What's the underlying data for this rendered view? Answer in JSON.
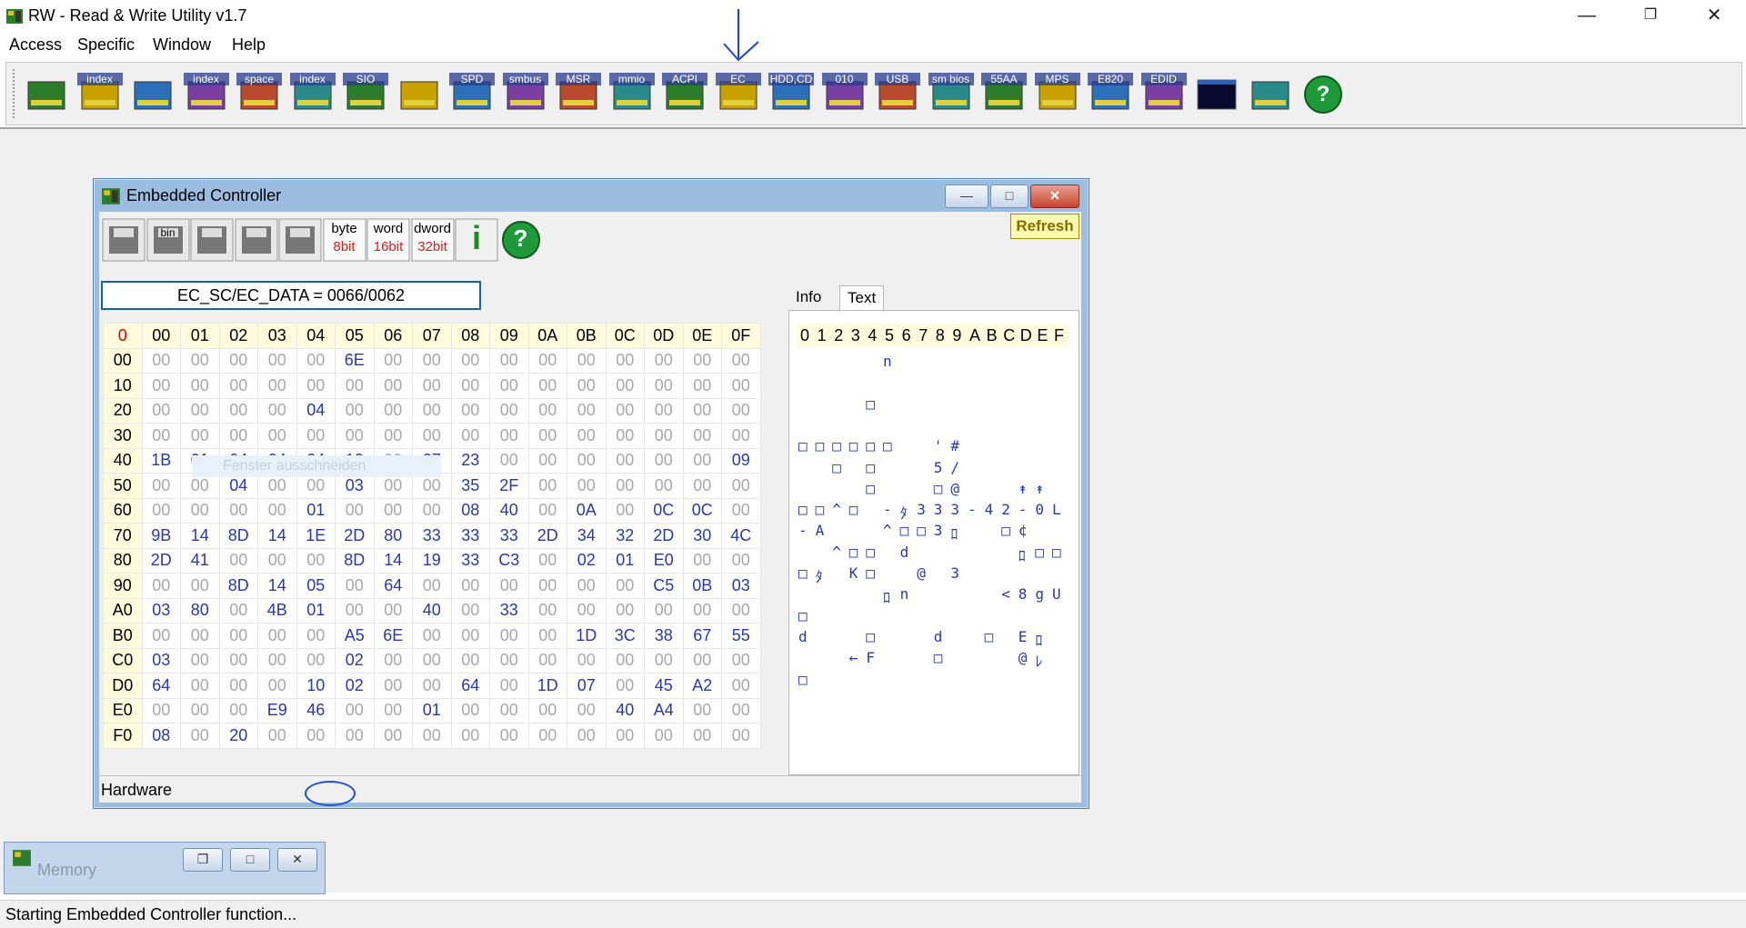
{
  "app": {
    "title": "RW - Read & Write Utility v1.7",
    "window_controls": {
      "minimize": "—",
      "restore": "❐",
      "close": "✕"
    }
  },
  "menu": [
    "Access",
    "Specific",
    "Window",
    "Help"
  ],
  "toolbar": {
    "tools": [
      {
        "name": "pci-tool-icon",
        "label": ""
      },
      {
        "name": "pci-index-tool-icon",
        "label": "index"
      },
      {
        "name": "memory-tool-icon",
        "label": ""
      },
      {
        "name": "memory-index-tool-icon",
        "label": "index"
      },
      {
        "name": "io-space-tool-icon",
        "label": "space"
      },
      {
        "name": "io-index-tool-icon",
        "label": "index"
      },
      {
        "name": "sio-tool-icon",
        "label": "SIO"
      },
      {
        "name": "waveform-tool-icon",
        "label": ""
      },
      {
        "name": "spd-tool-icon",
        "label": "SPD"
      },
      {
        "name": "smbus-tool-icon",
        "label": "smbus"
      },
      {
        "name": "msr-tool-icon",
        "label": "MSR"
      },
      {
        "name": "mmio-tool-icon",
        "label": "mmio"
      },
      {
        "name": "acpi-tool-icon",
        "label": "ACPI"
      },
      {
        "name": "ec-tool-icon",
        "label": "EC"
      },
      {
        "name": "hdd-cd-tool-icon",
        "label": "HDD,CD"
      },
      {
        "name": "disk-010-tool-icon",
        "label": "010"
      },
      {
        "name": "usb-tool-icon",
        "label": "USB"
      },
      {
        "name": "smbios-tool-icon",
        "label": "sm bios"
      },
      {
        "name": "55aa-tool-icon",
        "label": "55AA"
      },
      {
        "name": "mps-tool-icon",
        "label": "MPS"
      },
      {
        "name": "e820-tool-icon",
        "label": "E820"
      },
      {
        "name": "edid-tool-icon",
        "label": "EDID"
      },
      {
        "name": "command-window-tool-icon",
        "label": ""
      },
      {
        "name": "battery-tool-icon",
        "label": ""
      },
      {
        "name": "help-tool-icon",
        "label": "?"
      }
    ]
  },
  "ec_window": {
    "title": "Embedded Controller",
    "refresh_label": "Refresh",
    "tools": [
      {
        "name": "save-icon",
        "label": ""
      },
      {
        "name": "save-bin-icon",
        "label": "bin"
      },
      {
        "name": "load-icon",
        "label": ""
      },
      {
        "name": "find-binoculars-icon",
        "label": ""
      },
      {
        "name": "compare-icon",
        "label": ""
      },
      {
        "name": "byte-8bit-icon",
        "label": "byte",
        "sub": "8bit"
      },
      {
        "name": "word-16bit-icon",
        "label": "word",
        "sub": "16bit"
      },
      {
        "name": "dword-32bit-icon",
        "label": "dword",
        "sub": "32bit"
      },
      {
        "name": "info-icon",
        "label": "i"
      },
      {
        "name": "help-icon",
        "label": "?"
      }
    ],
    "address": "EC_SC/EC_DATA = 0066/0062",
    "grid": {
      "corner": "0",
      "col_headers": [
        "00",
        "01",
        "02",
        "03",
        "04",
        "05",
        "06",
        "07",
        "08",
        "09",
        "0A",
        "0B",
        "0C",
        "0D",
        "0E",
        "0F"
      ],
      "rows": [
        {
          "label": "00",
          "cells": [
            "00",
            "00",
            "00",
            "00",
            "00",
            "6E",
            "00",
            "00",
            "00",
            "00",
            "00",
            "00",
            "00",
            "00",
            "00",
            "00"
          ]
        },
        {
          "label": "10",
          "cells": [
            "00",
            "00",
            "00",
            "00",
            "00",
            "00",
            "00",
            "00",
            "00",
            "00",
            "00",
            "00",
            "00",
            "00",
            "00",
            "00"
          ]
        },
        {
          "label": "20",
          "cells": [
            "00",
            "00",
            "00",
            "00",
            "04",
            "00",
            "00",
            "00",
            "00",
            "00",
            "00",
            "00",
            "00",
            "00",
            "00",
            "00"
          ]
        },
        {
          "label": "30",
          "cells": [
            "00",
            "00",
            "00",
            "00",
            "00",
            "00",
            "00",
            "00",
            "00",
            "00",
            "00",
            "00",
            "00",
            "00",
            "00",
            "00"
          ]
        },
        {
          "label": "40",
          "cells": [
            "1B",
            "01",
            "04",
            "04",
            "04",
            "10",
            "00",
            "27",
            "23",
            "00",
            "00",
            "00",
            "00",
            "00",
            "00",
            "09"
          ]
        },
        {
          "label": "50",
          "cells": [
            "00",
            "00",
            "04",
            "00",
            "00",
            "03",
            "00",
            "00",
            "35",
            "2F",
            "00",
            "00",
            "00",
            "00",
            "00",
            "00"
          ]
        },
        {
          "label": "60",
          "cells": [
            "00",
            "00",
            "00",
            "00",
            "01",
            "00",
            "00",
            "00",
            "08",
            "40",
            "00",
            "0A",
            "00",
            "0C",
            "0C",
            "00"
          ]
        },
        {
          "label": "70",
          "cells": [
            "9B",
            "14",
            "8D",
            "14",
            "1E",
            "2D",
            "80",
            "33",
            "33",
            "33",
            "2D",
            "34",
            "32",
            "2D",
            "30",
            "4C"
          ]
        },
        {
          "label": "80",
          "cells": [
            "2D",
            "41",
            "00",
            "00",
            "00",
            "8D",
            "14",
            "19",
            "33",
            "C3",
            "00",
            "02",
            "01",
            "E0",
            "00",
            "00"
          ]
        },
        {
          "label": "90",
          "cells": [
            "00",
            "00",
            "8D",
            "14",
            "05",
            "00",
            "64",
            "00",
            "00",
            "00",
            "00",
            "00",
            "00",
            "C5",
            "0B",
            "03"
          ]
        },
        {
          "label": "A0",
          "cells": [
            "03",
            "80",
            "00",
            "4B",
            "01",
            "00",
            "00",
            "40",
            "00",
            "33",
            "00",
            "00",
            "00",
            "00",
            "00",
            "00"
          ]
        },
        {
          "label": "B0",
          "cells": [
            "00",
            "00",
            "00",
            "00",
            "00",
            "A5",
            "6E",
            "00",
            "00",
            "00",
            "00",
            "1D",
            "3C",
            "38",
            "67",
            "55"
          ]
        },
        {
          "label": "C0",
          "cells": [
            "03",
            "00",
            "00",
            "00",
            "00",
            "02",
            "00",
            "00",
            "00",
            "00",
            "00",
            "00",
            "00",
            "00",
            "00",
            "00"
          ]
        },
        {
          "label": "D0",
          "cells": [
            "64",
            "00",
            "00",
            "00",
            "10",
            "02",
            "00",
            "00",
            "64",
            "00",
            "1D",
            "07",
            "00",
            "45",
            "A2",
            "00"
          ]
        },
        {
          "label": "E0",
          "cells": [
            "00",
            "00",
            "00",
            "E9",
            "46",
            "00",
            "00",
            "01",
            "00",
            "00",
            "00",
            "00",
            "40",
            "A4",
            "00",
            "00"
          ]
        },
        {
          "label": "F0",
          "cells": [
            "08",
            "00",
            "20",
            "00",
            "00",
            "00",
            "00",
            "00",
            "00",
            "00",
            "00",
            "00",
            "00",
            "00",
            "00",
            "00"
          ]
        }
      ]
    },
    "tabs": [
      "Info",
      "Text"
    ],
    "active_tab": "Text",
    "text_header": "0123456789ABCDEF",
    "text_rows": [
      "     n          ",
      "                ",
      "    □           ",
      "                ",
      "□□□□□□  '#      ",
      "  □ □   5/      ",
      "    □   □@   ↟↟ ",
      "□□^□ -ﾀ333-42-0L",
      "-A   ^□□3ﾛ  □¢  ",
      "  ^□□ d      ﾛ□□",
      "□ﾀ K□  @ 3      ",
      "     ﾛn     <8gU",
      "□               ",
      "d   □   d  □ Eﾛ ",
      "   ←F   □    @ﾚ ",
      "□               "
    ],
    "ghost_text": "Fenster ausschneiden",
    "status": "Hardware"
  },
  "memory_window": {
    "title": "Memory"
  },
  "statusbar": "Starting Embedded Controller function...",
  "colors": {
    "accent_nonzero": "#2a38a8",
    "zero": "#a8a8a8",
    "header_bg": "#fffbdc",
    "annotation": "#1f4fd6"
  }
}
